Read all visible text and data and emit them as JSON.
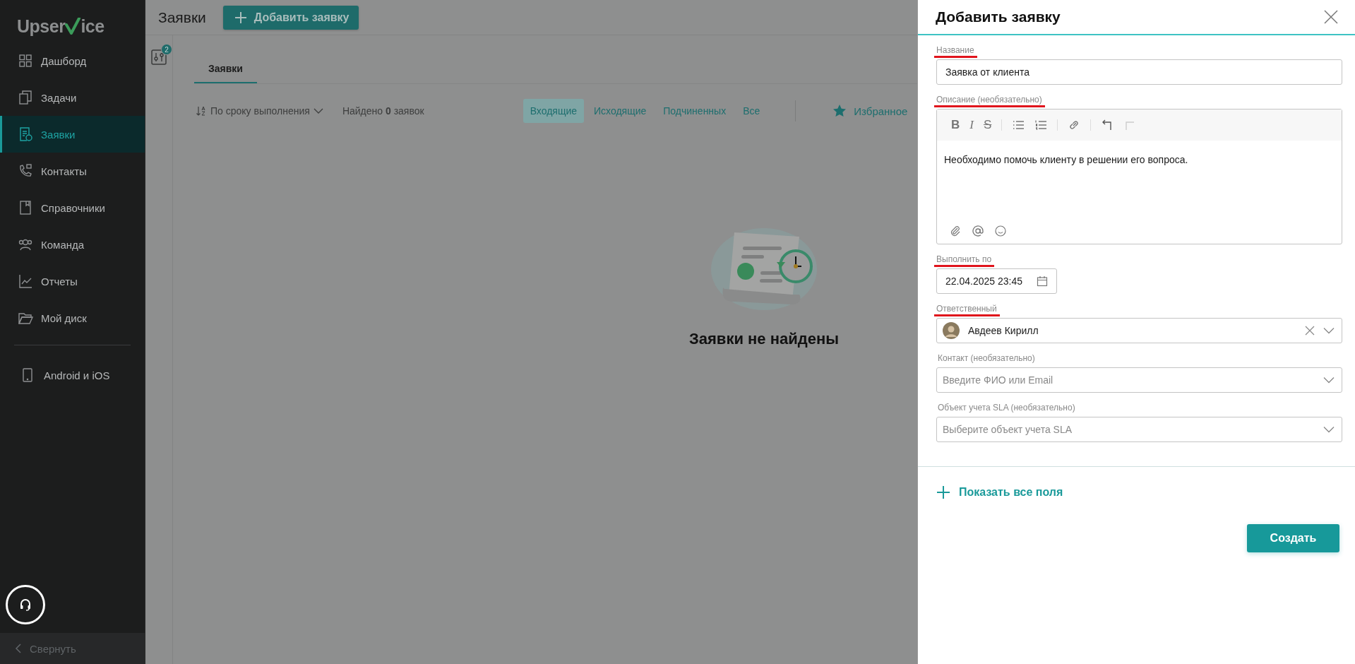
{
  "sidebar": {
    "logo": {
      "before": "Upser",
      "after": "ice"
    },
    "items": [
      {
        "label": "Дашборд",
        "selected": false
      },
      {
        "label": "Задачи",
        "selected": false
      },
      {
        "label": "Заявки",
        "selected": true
      },
      {
        "label": "Контакты",
        "selected": false
      },
      {
        "label": "Справочники",
        "selected": false
      },
      {
        "label": "Команда",
        "selected": false
      },
      {
        "label": "Отчеты",
        "selected": false
      },
      {
        "label": "Мой диск",
        "selected": false
      }
    ],
    "apps_item": "Android и iOS",
    "collapse": "Свернуть"
  },
  "header": {
    "title": "Заявки",
    "add_button": "Добавить заявку"
  },
  "filter_badge": "2",
  "tabs": [
    {
      "label": "Заявки",
      "selected": true
    }
  ],
  "toolbar": {
    "sort": "По сроку выполнения",
    "found": "Найдено **0** заявок",
    "filters": [
      {
        "label": "Входящие",
        "selected": true
      },
      {
        "label": "Исходящие",
        "selected": false
      },
      {
        "label": "Подчиненных",
        "selected": false
      },
      {
        "label": "Все",
        "selected": false
      }
    ],
    "favorite": "Избранное"
  },
  "empty_state": "Заявки не найдены",
  "panel": {
    "title": "Добавить заявку",
    "fields": [
      {
        "kind": "text",
        "label": "Название",
        "underlined": true,
        "value": "Заявка от клиента"
      },
      {
        "kind": "editor",
        "label": "Описание (необязательно)",
        "underlined": true,
        "format_buttons": [
          "B",
          "I",
          "S"
        ],
        "value": "Необходимо помочь клиенту в решении его вопроса."
      },
      {
        "kind": "date",
        "label": "Выполнить по",
        "underlined": true,
        "value": "22.04.2025 23:45"
      },
      {
        "kind": "person",
        "label": "Ответственный",
        "underlined": true,
        "value": "Авдеев Кирилл"
      },
      {
        "kind": "combo",
        "label": "Контакт (необязательно)",
        "underlined": false,
        "placeholder": "Введите ФИО или Email"
      },
      {
        "kind": "combo",
        "label": "Объект учета SLA (необязательно)",
        "underlined": false,
        "placeholder": "Выберите объект учета SLA"
      }
    ],
    "show_all": "Показать все поля",
    "submit": "Создать"
  }
}
